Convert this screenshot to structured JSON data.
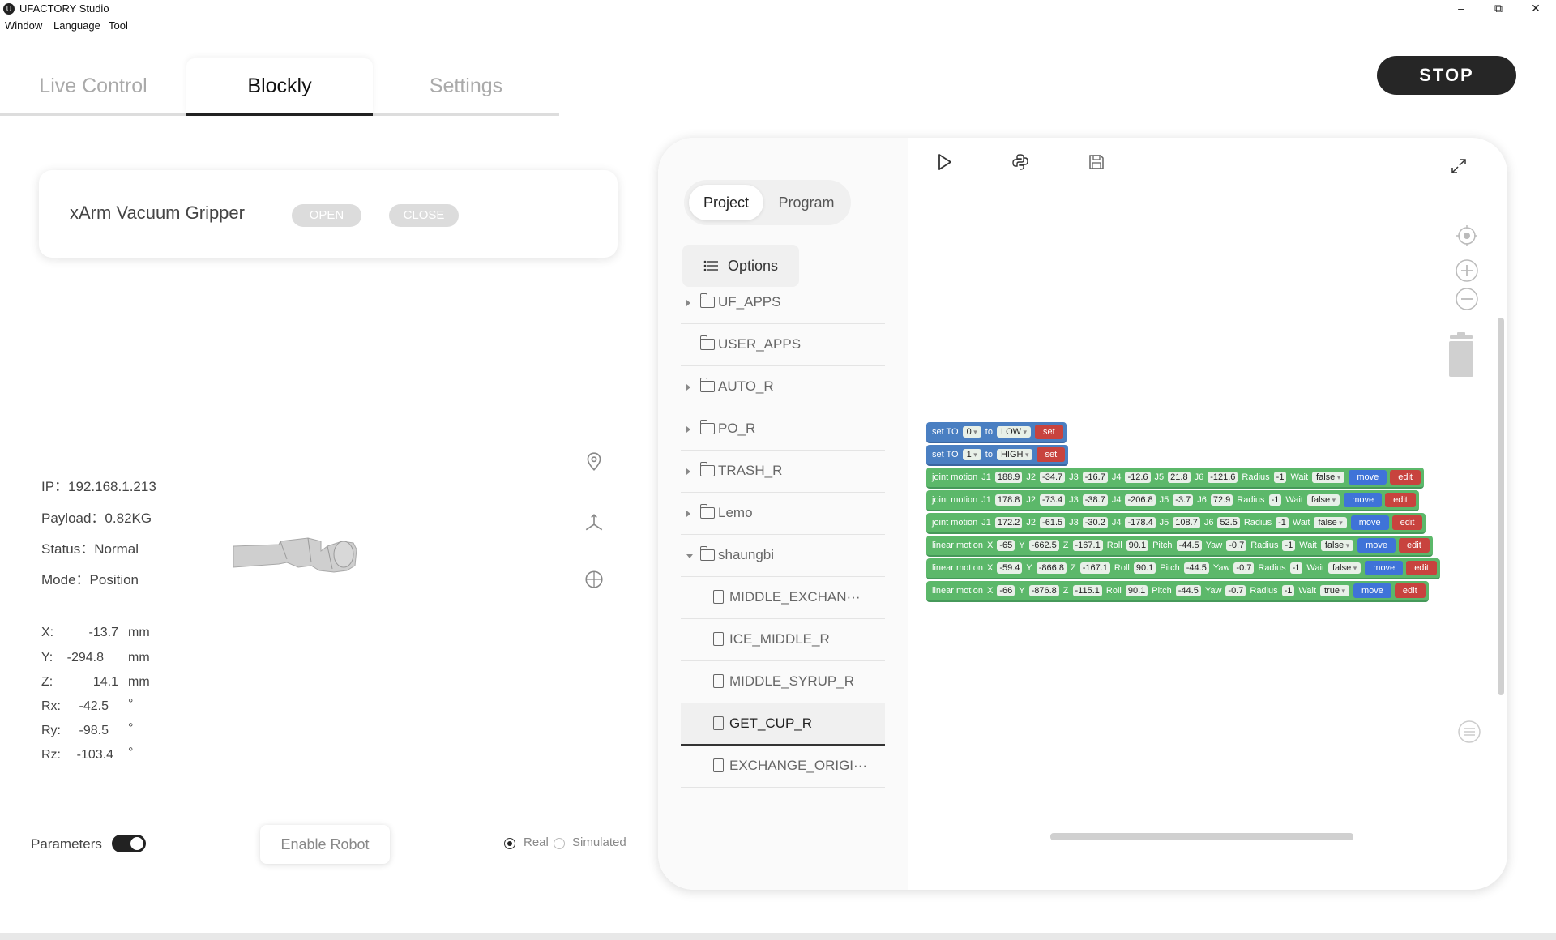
{
  "window": {
    "title": "UFACTORY Studio",
    "minimize": "–",
    "maximize": "⧉",
    "close": "✕"
  },
  "menu": [
    "Window",
    "Language",
    "Tool"
  ],
  "tabs": [
    {
      "label": "Live Control",
      "active": false
    },
    {
      "label": "Blockly",
      "active": true
    },
    {
      "label": "Settings",
      "active": false
    }
  ],
  "stop_label": "STOP",
  "gripper": {
    "name": "xArm Vacuum Gripper",
    "open_label": "OPEN",
    "close_label": "CLOSE"
  },
  "robot_info": {
    "ip": "IP：192.168.1.213",
    "payload": "Payload：0.82KG",
    "status": "Status：Normal",
    "mode": "Mode：Position"
  },
  "coords": [
    {
      "label": "X:",
      "value": "-13.7",
      "unit": "mm"
    },
    {
      "label": "Y:",
      "value": "-294.8",
      "unit": "mm"
    },
    {
      "label": "Z:",
      "value": "14.1",
      "unit": "mm"
    },
    {
      "label": "Rx:",
      "value": "-42.5",
      "unit": "°"
    },
    {
      "label": "Ry:",
      "value": "-98.5",
      "unit": "°"
    },
    {
      "label": "Rz:",
      "value": "-103.4",
      "unit": "°"
    }
  ],
  "controls": {
    "parameters_label": "Parameters",
    "parameters_on": true,
    "enable_robot_label": "Enable Robot",
    "real_label": "Real",
    "simulated_label": "Simulated",
    "selected_mode": "Real"
  },
  "project_panel": {
    "seg_project": "Project",
    "seg_program": "Program",
    "options_label": "Options",
    "tree": [
      {
        "label": "UF_APPS",
        "type": "folder",
        "expandable": true,
        "expanded": false
      },
      {
        "label": "USER_APPS",
        "type": "folder",
        "expandable": false,
        "expanded": false
      },
      {
        "label": "AUTO_R",
        "type": "folder",
        "expandable": true,
        "expanded": false
      },
      {
        "label": "PO_R",
        "type": "folder",
        "expandable": true,
        "expanded": false
      },
      {
        "label": "TRASH_R",
        "type": "folder",
        "expandable": true,
        "expanded": false
      },
      {
        "label": "Lemo",
        "type": "folder",
        "expandable": true,
        "expanded": false
      },
      {
        "label": "shaungbi",
        "type": "folder",
        "expandable": true,
        "expanded": true
      },
      {
        "label": "MIDDLE_EXCHAN···",
        "type": "file"
      },
      {
        "label": "ICE_MIDDLE_R",
        "type": "file"
      },
      {
        "label": "MIDDLE_SYRUP_R",
        "type": "file"
      },
      {
        "label": "GET_CUP_R",
        "type": "file",
        "selected": true
      },
      {
        "label": "EXCHANGE_ORIGI···",
        "type": "file"
      }
    ]
  },
  "blocks": [
    {
      "color": "blue",
      "parts": [
        [
          "t",
          "set TO"
        ],
        [
          "d",
          "0"
        ],
        [
          "t",
          "to"
        ],
        [
          "d",
          "LOW"
        ],
        [
          "s",
          "set"
        ]
      ]
    },
    {
      "color": "blue",
      "parts": [
        [
          "t",
          "set TO"
        ],
        [
          "d",
          "1"
        ],
        [
          "t",
          "to"
        ],
        [
          "d",
          "HIGH"
        ],
        [
          "s",
          "set"
        ]
      ]
    },
    {
      "color": "green",
      "parts": [
        [
          "t",
          "joint motion"
        ],
        [
          "t",
          "J1"
        ],
        [
          "f",
          "188.9"
        ],
        [
          "t",
          "J2"
        ],
        [
          "f",
          "-34.7"
        ],
        [
          "t",
          "J3"
        ],
        [
          "f",
          "-16.7"
        ],
        [
          "t",
          "J4"
        ],
        [
          "f",
          "-12.6"
        ],
        [
          "t",
          "J5"
        ],
        [
          "f",
          "21.8"
        ],
        [
          "t",
          "J6"
        ],
        [
          "f",
          "-121.6"
        ],
        [
          "t",
          "Radius"
        ],
        [
          "f",
          "-1"
        ],
        [
          "t",
          "Wait"
        ],
        [
          "d",
          "false"
        ],
        [
          "m",
          "move"
        ],
        [
          "e",
          "edit"
        ]
      ]
    },
    {
      "color": "green",
      "parts": [
        [
          "t",
          "joint motion"
        ],
        [
          "t",
          "J1"
        ],
        [
          "f",
          "178.8"
        ],
        [
          "t",
          "J2"
        ],
        [
          "f",
          "-73.4"
        ],
        [
          "t",
          "J3"
        ],
        [
          "f",
          "-38.7"
        ],
        [
          "t",
          "J4"
        ],
        [
          "f",
          "-206.8"
        ],
        [
          "t",
          "J5"
        ],
        [
          "f",
          "-3.7"
        ],
        [
          "t",
          "J6"
        ],
        [
          "f",
          "72.9"
        ],
        [
          "t",
          "Radius"
        ],
        [
          "f",
          "-1"
        ],
        [
          "t",
          "Wait"
        ],
        [
          "d",
          "false"
        ],
        [
          "m",
          "move"
        ],
        [
          "e",
          "edit"
        ]
      ]
    },
    {
      "color": "green",
      "parts": [
        [
          "t",
          "joint motion"
        ],
        [
          "t",
          "J1"
        ],
        [
          "f",
          "172.2"
        ],
        [
          "t",
          "J2"
        ],
        [
          "f",
          "-61.5"
        ],
        [
          "t",
          "J3"
        ],
        [
          "f",
          "-30.2"
        ],
        [
          "t",
          "J4"
        ],
        [
          "f",
          "-178.4"
        ],
        [
          "t",
          "J5"
        ],
        [
          "f",
          "108.7"
        ],
        [
          "t",
          "J6"
        ],
        [
          "f",
          "52.5"
        ],
        [
          "t",
          "Radius"
        ],
        [
          "f",
          "-1"
        ],
        [
          "t",
          "Wait"
        ],
        [
          "d",
          "false"
        ],
        [
          "m",
          "move"
        ],
        [
          "e",
          "edit"
        ]
      ]
    },
    {
      "color": "green",
      "parts": [
        [
          "t",
          "linear motion"
        ],
        [
          "t",
          "X"
        ],
        [
          "f",
          "-65"
        ],
        [
          "t",
          "Y"
        ],
        [
          "f",
          "-662.5"
        ],
        [
          "t",
          "Z"
        ],
        [
          "f",
          "-167.1"
        ],
        [
          "t",
          "Roll"
        ],
        [
          "f",
          "90.1"
        ],
        [
          "t",
          "Pitch"
        ],
        [
          "f",
          "-44.5"
        ],
        [
          "t",
          "Yaw"
        ],
        [
          "f",
          "-0.7"
        ],
        [
          "t",
          "Radius"
        ],
        [
          "f",
          "-1"
        ],
        [
          "t",
          "Wait"
        ],
        [
          "d",
          "false"
        ],
        [
          "m",
          "move"
        ],
        [
          "e",
          "edit"
        ]
      ]
    },
    {
      "color": "green",
      "parts": [
        [
          "t",
          "linear motion"
        ],
        [
          "t",
          "X"
        ],
        [
          "f",
          "-59.4"
        ],
        [
          "t",
          "Y"
        ],
        [
          "f",
          "-866.8"
        ],
        [
          "t",
          "Z"
        ],
        [
          "f",
          "-167.1"
        ],
        [
          "t",
          "Roll"
        ],
        [
          "f",
          "90.1"
        ],
        [
          "t",
          "Pitch"
        ],
        [
          "f",
          "-44.5"
        ],
        [
          "t",
          "Yaw"
        ],
        [
          "f",
          "-0.7"
        ],
        [
          "t",
          "Radius"
        ],
        [
          "f",
          "-1"
        ],
        [
          "t",
          "Wait"
        ],
        [
          "d",
          "false"
        ],
        [
          "m",
          "move"
        ],
        [
          "e",
          "edit"
        ]
      ]
    },
    {
      "color": "green",
      "parts": [
        [
          "t",
          "linear motion"
        ],
        [
          "t",
          "X"
        ],
        [
          "f",
          "-66"
        ],
        [
          "t",
          "Y"
        ],
        [
          "f",
          "-876.8"
        ],
        [
          "t",
          "Z"
        ],
        [
          "f",
          "-115.1"
        ],
        [
          "t",
          "Roll"
        ],
        [
          "f",
          "90.1"
        ],
        [
          "t",
          "Pitch"
        ],
        [
          "f",
          "-44.5"
        ],
        [
          "t",
          "Yaw"
        ],
        [
          "f",
          "-0.7"
        ],
        [
          "t",
          "Radius"
        ],
        [
          "f",
          "-1"
        ],
        [
          "t",
          "Wait"
        ],
        [
          "d",
          "true"
        ],
        [
          "m",
          "move"
        ],
        [
          "e",
          "edit"
        ]
      ]
    }
  ],
  "icons": {
    "app_logo": "ufactory-logo-icon",
    "run": "play-icon",
    "python": "python-icon",
    "save": "save-icon",
    "fullscreen": "expand-icon",
    "recenter": "crosshair-icon",
    "zoom_in": "zoom-in-icon",
    "zoom_out": "zoom-out-icon",
    "trash": "trash-icon",
    "location": "map-pin-icon",
    "axes": "axes-icon",
    "target": "target-icon",
    "list": "list-icon"
  },
  "colors": {
    "accent_dark": "#262626",
    "block_blue": "#4a7fc2",
    "block_green": "#5cb86a",
    "block_move": "#3f73d8",
    "block_edit": "#c8433e"
  }
}
